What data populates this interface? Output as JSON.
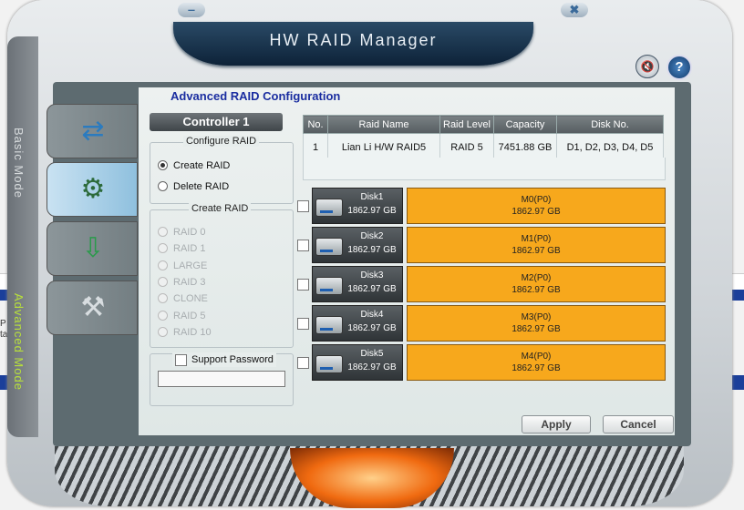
{
  "app": {
    "title": "HW RAID Manager",
    "minimize_glyph": "‒",
    "close_glyph": "✖"
  },
  "side_modes": {
    "basic": "Basic Mode",
    "advanced": "Advanced Mode"
  },
  "background": {
    "left_text": "P\nta"
  },
  "header_icons": [
    {
      "name": "mute-icon",
      "glyph": "🔇"
    },
    {
      "name": "help-icon",
      "glyph": "?"
    }
  ],
  "tabs": [
    {
      "name": "transfer-icon",
      "glyph": "⇄",
      "active": false
    },
    {
      "name": "raid-config-icon",
      "glyph": "⚙",
      "active": true
    },
    {
      "name": "download-memory-icon",
      "glyph": "⇩",
      "active": false
    },
    {
      "name": "tools-gear-icon",
      "glyph": "⚒",
      "active": false
    }
  ],
  "main": {
    "heading": "Advanced RAID Configuration",
    "controller": "Controller 1",
    "configure_group_title": "Configure RAID",
    "configure_options": [
      "Create RAID",
      "Delete RAID"
    ],
    "configure_selected": "Create RAID",
    "create_group_title": "Create RAID",
    "raid_levels": [
      "RAID 0",
      "RAID 1",
      "LARGE",
      "RAID 3",
      "CLONE",
      "RAID 5",
      "RAID 10"
    ],
    "support_password_label": "Support Password",
    "password_value": ""
  },
  "table": {
    "headers": [
      "No.",
      "Raid Name",
      "Raid Level",
      "Capacity",
      "Disk No."
    ],
    "rows": [
      [
        "1",
        "Lian Li H/W RAID5",
        "RAID 5",
        "7451.88 GB",
        "D1, D2, D3, D4, D5"
      ]
    ]
  },
  "disks": [
    {
      "name": "Disk1",
      "capacity": "1862.97 GB",
      "member": "M0(P0)",
      "member_capacity": "1862.97 GB"
    },
    {
      "name": "Disk2",
      "capacity": "1862.97 GB",
      "member": "M1(P0)",
      "member_capacity": "1862.97 GB"
    },
    {
      "name": "Disk3",
      "capacity": "1862.97 GB",
      "member": "M2(P0)",
      "member_capacity": "1862.97 GB"
    },
    {
      "name": "Disk4",
      "capacity": "1862.97 GB",
      "member": "M3(P0)",
      "member_capacity": "1862.97 GB"
    },
    {
      "name": "Disk5",
      "capacity": "1862.97 GB",
      "member": "M4(P0)",
      "member_capacity": "1862.97 GB"
    }
  ],
  "buttons": {
    "apply": "Apply",
    "cancel": "Cancel"
  },
  "colors": {
    "member_fill": "#f7a81c",
    "title_bar": "#0d2238",
    "heading": "#1a2da0"
  }
}
